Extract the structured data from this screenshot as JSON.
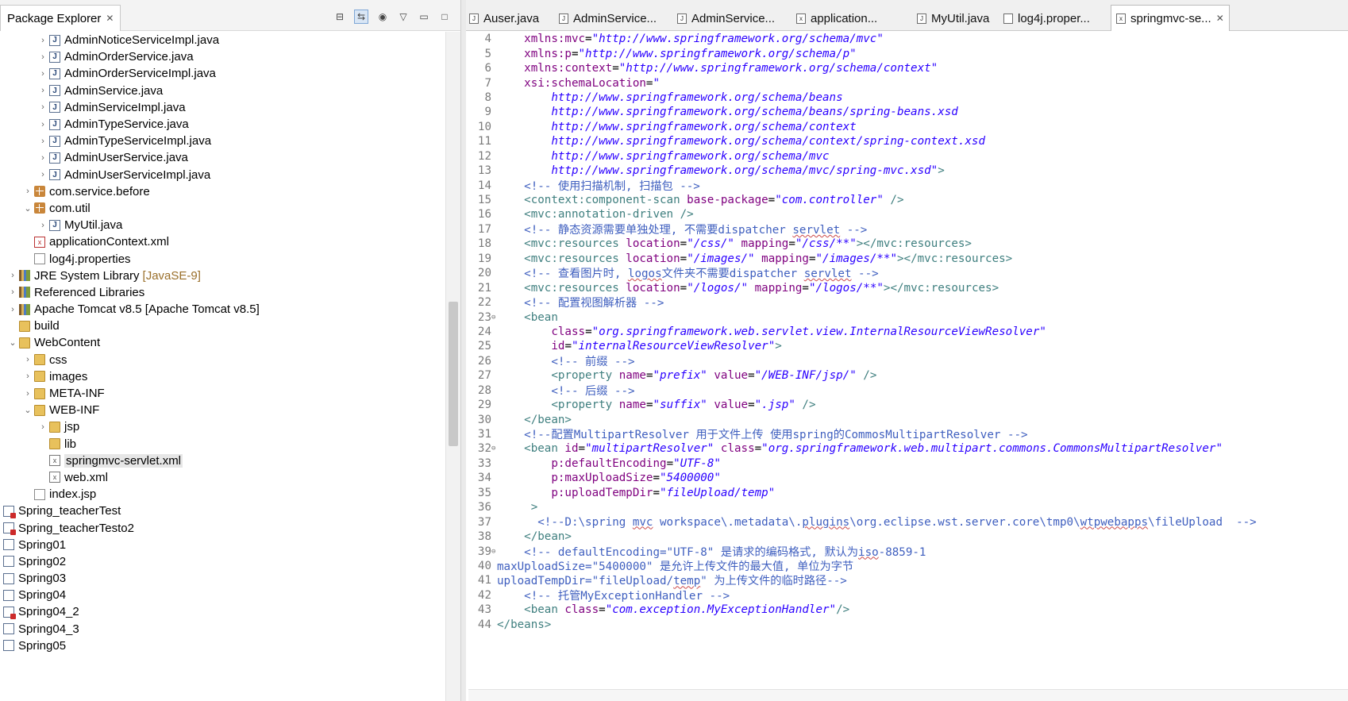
{
  "explorer": {
    "title": "Package Explorer",
    "items": [
      {
        "label": "AdminNoticeServiceImpl.java",
        "type": "java",
        "indent": 2,
        "twisty": "collapsed"
      },
      {
        "label": "AdminOrderService.java",
        "type": "java",
        "indent": 2,
        "twisty": "collapsed"
      },
      {
        "label": "AdminOrderServiceImpl.java",
        "type": "java",
        "indent": 2,
        "twisty": "collapsed"
      },
      {
        "label": "AdminService.java",
        "type": "java",
        "indent": 2,
        "twisty": "collapsed"
      },
      {
        "label": "AdminServiceImpl.java",
        "type": "java",
        "indent": 2,
        "twisty": "collapsed"
      },
      {
        "label": "AdminTypeService.java",
        "type": "java",
        "indent": 2,
        "twisty": "collapsed"
      },
      {
        "label": "AdminTypeServiceImpl.java",
        "type": "java",
        "indent": 2,
        "twisty": "collapsed"
      },
      {
        "label": "AdminUserService.java",
        "type": "java",
        "indent": 2,
        "twisty": "collapsed"
      },
      {
        "label": "AdminUserServiceImpl.java",
        "type": "java",
        "indent": 2,
        "twisty": "collapsed"
      },
      {
        "label": "com.service.before",
        "type": "package",
        "indent": 1,
        "twisty": "collapsed"
      },
      {
        "label": "com.util",
        "type": "package",
        "indent": 1,
        "twisty": "expanded"
      },
      {
        "label": "MyUtil.java",
        "type": "java",
        "indent": 2,
        "twisty": "collapsed"
      },
      {
        "label": "applicationContext.xml",
        "type": "xml-red",
        "indent": 1,
        "twisty": "none"
      },
      {
        "label": "log4j.properties",
        "type": "file",
        "indent": 1,
        "twisty": "none"
      },
      {
        "label": "JRE System Library",
        "decoration": "[JavaSE-9]",
        "type": "lib",
        "indent": 0,
        "twisty": "collapsed"
      },
      {
        "label": "Referenced Libraries",
        "type": "lib",
        "indent": 0,
        "twisty": "collapsed"
      },
      {
        "label": "Apache Tomcat v8.5 [Apache Tomcat v8.5]",
        "type": "lib",
        "indent": 0,
        "twisty": "collapsed"
      },
      {
        "label": "build",
        "type": "folder",
        "indent": 0,
        "twisty": "none"
      },
      {
        "label": "WebContent",
        "type": "folder",
        "indent": 0,
        "twisty": "expanded"
      },
      {
        "label": "css",
        "type": "folder",
        "indent": 1,
        "twisty": "collapsed"
      },
      {
        "label": "images",
        "type": "folder",
        "indent": 1,
        "twisty": "collapsed"
      },
      {
        "label": "META-INF",
        "type": "folder",
        "indent": 1,
        "twisty": "collapsed"
      },
      {
        "label": "WEB-INF",
        "type": "folder",
        "indent": 1,
        "twisty": "expanded"
      },
      {
        "label": "jsp",
        "type": "folder",
        "indent": 2,
        "twisty": "collapsed"
      },
      {
        "label": "lib",
        "type": "folder",
        "indent": 2,
        "twisty": "none"
      },
      {
        "label": "springmvc-servlet.xml",
        "type": "xml",
        "indent": 2,
        "twisty": "none",
        "selected": true
      },
      {
        "label": "web.xml",
        "type": "xml",
        "indent": 2,
        "twisty": "none"
      },
      {
        "label": "index.jsp",
        "type": "jsp",
        "indent": 1,
        "twisty": "none"
      },
      {
        "label": "Spring_teacherTest",
        "type": "project-err",
        "indent": -1,
        "twisty": "none"
      },
      {
        "label": "Spring_teacherTesto2",
        "type": "project-err",
        "indent": -1,
        "twisty": "none"
      },
      {
        "label": "Spring01",
        "type": "project",
        "indent": -1,
        "twisty": "none"
      },
      {
        "label": "Spring02",
        "type": "project",
        "indent": -1,
        "twisty": "none"
      },
      {
        "label": "Spring03",
        "type": "project",
        "indent": -1,
        "twisty": "none"
      },
      {
        "label": "Spring04",
        "type": "project",
        "indent": -1,
        "twisty": "none"
      },
      {
        "label": "Spring04_2",
        "type": "project-err",
        "indent": -1,
        "twisty": "none"
      },
      {
        "label": "Spring04_3",
        "type": "project",
        "indent": -1,
        "twisty": "none"
      },
      {
        "label": "Spring05",
        "type": "project",
        "indent": -1,
        "twisty": "none"
      }
    ]
  },
  "editor_tabs": [
    {
      "label": "Auser.java",
      "icon": "java-icon"
    },
    {
      "label": "AdminService...",
      "icon": "java-icon"
    },
    {
      "label": "AdminService...",
      "icon": "java-icon"
    },
    {
      "label": "application...",
      "icon": "xml-icon"
    },
    {
      "label": "MyUtil.java",
      "icon": "java-icon"
    },
    {
      "label": "log4j.proper...",
      "icon": "file-icon"
    },
    {
      "label": "springmvc-se...",
      "icon": "xml-icon",
      "active": true
    }
  ],
  "code_lines": [
    {
      "n": "4",
      "segs": [
        [
          "p",
          "    "
        ],
        [
          "a",
          "xmlns:mvc"
        ],
        [
          "p",
          "="
        ],
        [
          "v",
          "\"http://www.springframework.org/schema/mvc\""
        ]
      ]
    },
    {
      "n": "5",
      "segs": [
        [
          "p",
          "    "
        ],
        [
          "a",
          "xmlns:p"
        ],
        [
          "p",
          "="
        ],
        [
          "v",
          "\"http://www.springframework.org/schema/p\""
        ]
      ]
    },
    {
      "n": "6",
      "segs": [
        [
          "p",
          "    "
        ],
        [
          "a",
          "xmlns:context"
        ],
        [
          "p",
          "="
        ],
        [
          "v",
          "\"http://www.springframework.org/schema/context\""
        ]
      ]
    },
    {
      "n": "7",
      "segs": [
        [
          "p",
          "    "
        ],
        [
          "a",
          "xsi:schemaLocation"
        ],
        [
          "p",
          "="
        ],
        [
          "v",
          "\""
        ]
      ]
    },
    {
      "n": "8",
      "segs": [
        [
          "p",
          "        "
        ],
        [
          "v",
          "http://www.springframework.org/schema/beans"
        ]
      ]
    },
    {
      "n": "9",
      "segs": [
        [
          "p",
          "        "
        ],
        [
          "v",
          "http://www.springframework.org/schema/beans/spring-beans.xsd"
        ]
      ]
    },
    {
      "n": "10",
      "segs": [
        [
          "p",
          "        "
        ],
        [
          "v",
          "http://www.springframework.org/schema/context"
        ]
      ]
    },
    {
      "n": "11",
      "segs": [
        [
          "p",
          "        "
        ],
        [
          "v",
          "http://www.springframework.org/schema/context/spring-context.xsd"
        ]
      ]
    },
    {
      "n": "12",
      "segs": [
        [
          "p",
          "        "
        ],
        [
          "v",
          "http://www.springframework.org/schema/mvc"
        ]
      ]
    },
    {
      "n": "13",
      "segs": [
        [
          "p",
          "        "
        ],
        [
          "v",
          "http://www.springframework.org/schema/mvc/spring-mvc.xsd\""
        ],
        [
          "t",
          ">"
        ]
      ]
    },
    {
      "n": "14",
      "segs": [
        [
          "p",
          "    "
        ],
        [
          "c",
          "<!-- 使用扫描机制, 扫描包 -->"
        ]
      ]
    },
    {
      "n": "15",
      "segs": [
        [
          "p",
          "    "
        ],
        [
          "t",
          "<context:component-scan "
        ],
        [
          "a",
          "base-package"
        ],
        [
          "p",
          "="
        ],
        [
          "v",
          "\"com.controller\""
        ],
        [
          "t",
          " />"
        ]
      ]
    },
    {
      "n": "16",
      "segs": [
        [
          "p",
          "    "
        ],
        [
          "t",
          "<mvc:annotation-driven />"
        ]
      ]
    },
    {
      "n": "17",
      "segs": [
        [
          "p",
          "    "
        ],
        [
          "c",
          "<!-- 静态资源需要单独处理, 不需要dispatcher "
        ],
        [
          "csq",
          "servlet"
        ],
        [
          "c",
          " -->"
        ]
      ]
    },
    {
      "n": "18",
      "segs": [
        [
          "p",
          "    "
        ],
        [
          "t",
          "<mvc:resources "
        ],
        [
          "a",
          "location"
        ],
        [
          "p",
          "="
        ],
        [
          "v",
          "\"/css/\""
        ],
        [
          "p",
          " "
        ],
        [
          "a",
          "mapping"
        ],
        [
          "p",
          "="
        ],
        [
          "v",
          "\"/css/**\""
        ],
        [
          "t",
          "></mvc:resources>"
        ]
      ]
    },
    {
      "n": "19",
      "segs": [
        [
          "p",
          "    "
        ],
        [
          "t",
          "<mvc:resources "
        ],
        [
          "a",
          "location"
        ],
        [
          "p",
          "="
        ],
        [
          "v",
          "\"/images/\""
        ],
        [
          "p",
          " "
        ],
        [
          "a",
          "mapping"
        ],
        [
          "p",
          "="
        ],
        [
          "v",
          "\"/images/**\""
        ],
        [
          "t",
          "></mvc:resources>"
        ]
      ]
    },
    {
      "n": "20",
      "segs": [
        [
          "p",
          "    "
        ],
        [
          "c",
          "<!-- 查看图片时, "
        ],
        [
          "csq",
          "logos"
        ],
        [
          "c",
          "文件夹不需要dispatcher "
        ],
        [
          "csq",
          "servlet"
        ],
        [
          "c",
          " -->"
        ]
      ]
    },
    {
      "n": "21",
      "segs": [
        [
          "p",
          "    "
        ],
        [
          "t",
          "<mvc:resources "
        ],
        [
          "a",
          "location"
        ],
        [
          "p",
          "="
        ],
        [
          "v",
          "\"/logos/\""
        ],
        [
          "p",
          " "
        ],
        [
          "a",
          "mapping"
        ],
        [
          "p",
          "="
        ],
        [
          "v",
          "\"/logos/**\""
        ],
        [
          "t",
          "></mvc:resources>"
        ]
      ]
    },
    {
      "n": "22",
      "segs": [
        [
          "p",
          "    "
        ],
        [
          "c",
          "<!-- 配置视图解析器 -->"
        ]
      ]
    },
    {
      "n": "23",
      "fold": "⊖",
      "segs": [
        [
          "p",
          "    "
        ],
        [
          "t",
          "<bean"
        ]
      ]
    },
    {
      "n": "24",
      "segs": [
        [
          "p",
          "        "
        ],
        [
          "a",
          "class"
        ],
        [
          "p",
          "="
        ],
        [
          "v",
          "\"org.springframework.web.servlet.view.InternalResourceViewResolver\""
        ]
      ]
    },
    {
      "n": "25",
      "segs": [
        [
          "p",
          "        "
        ],
        [
          "a",
          "id"
        ],
        [
          "p",
          "="
        ],
        [
          "v",
          "\"internalResourceViewResolver\""
        ],
        [
          "t",
          ">"
        ]
      ]
    },
    {
      "n": "26",
      "segs": [
        [
          "p",
          "        "
        ],
        [
          "c",
          "<!-- 前缀 -->"
        ]
      ]
    },
    {
      "n": "27",
      "segs": [
        [
          "p",
          "        "
        ],
        [
          "t",
          "<property "
        ],
        [
          "a",
          "name"
        ],
        [
          "p",
          "="
        ],
        [
          "v",
          "\"prefix\""
        ],
        [
          "p",
          " "
        ],
        [
          "a",
          "value"
        ],
        [
          "p",
          "="
        ],
        [
          "v",
          "\"/WEB-INF/jsp/\""
        ],
        [
          "t",
          " />"
        ]
      ]
    },
    {
      "n": "28",
      "segs": [
        [
          "p",
          "        "
        ],
        [
          "c",
          "<!-- 后缀 -->"
        ]
      ]
    },
    {
      "n": "29",
      "segs": [
        [
          "p",
          "        "
        ],
        [
          "t",
          "<property "
        ],
        [
          "a",
          "name"
        ],
        [
          "p",
          "="
        ],
        [
          "v",
          "\"suffix\""
        ],
        [
          "p",
          " "
        ],
        [
          "a",
          "value"
        ],
        [
          "p",
          "="
        ],
        [
          "v",
          "\".jsp\""
        ],
        [
          "t",
          " />"
        ]
      ]
    },
    {
      "n": "30",
      "segs": [
        [
          "p",
          "    "
        ],
        [
          "t",
          "</bean>"
        ]
      ]
    },
    {
      "n": "31",
      "segs": [
        [
          "p",
          "    "
        ],
        [
          "c",
          "<!--配置MultipartResolver 用于文件上传 使用spring的CommosMultipartResolver -->"
        ]
      ]
    },
    {
      "n": "32",
      "fold": "⊖",
      "segs": [
        [
          "p",
          "    "
        ],
        [
          "t",
          "<bean "
        ],
        [
          "a",
          "id"
        ],
        [
          "p",
          "="
        ],
        [
          "v",
          "\"multipartResolver\""
        ],
        [
          "p",
          " "
        ],
        [
          "a",
          "class"
        ],
        [
          "p",
          "="
        ],
        [
          "v",
          "\"org.springframework.web.multipart.commons.CommonsMultipartResolver\""
        ]
      ]
    },
    {
      "n": "33",
      "segs": [
        [
          "p",
          "        "
        ],
        [
          "a",
          "p:defaultEncoding"
        ],
        [
          "p",
          "="
        ],
        [
          "v",
          "\"UTF-8\""
        ]
      ]
    },
    {
      "n": "34",
      "segs": [
        [
          "p",
          "        "
        ],
        [
          "a",
          "p:maxUploadSize"
        ],
        [
          "p",
          "="
        ],
        [
          "v",
          "\"5400000\""
        ]
      ]
    },
    {
      "n": "35",
      "segs": [
        [
          "p",
          "        "
        ],
        [
          "a",
          "p:uploadTempDir"
        ],
        [
          "p",
          "="
        ],
        [
          "v",
          "\"fileUpload/temp\""
        ]
      ]
    },
    {
      "n": "36",
      "segs": [
        [
          "p",
          "     "
        ],
        [
          "t",
          ">"
        ]
      ]
    },
    {
      "n": "37",
      "segs": [
        [
          "p",
          "      "
        ],
        [
          "c",
          "<!--D:\\spring "
        ],
        [
          "csq",
          "mvc"
        ],
        [
          "c",
          " workspace\\.metadata\\."
        ],
        [
          "csq",
          "plugins"
        ],
        [
          "c",
          "\\org.eclipse.wst.server.core\\tmp0\\"
        ],
        [
          "csq",
          "wtpwebapps"
        ],
        [
          "c",
          "\\fileUpload  -->"
        ]
      ]
    },
    {
      "n": "38",
      "segs": [
        [
          "p",
          "    "
        ],
        [
          "t",
          "</bean>"
        ]
      ]
    },
    {
      "n": "39",
      "fold": "⊖",
      "segs": [
        [
          "p",
          "    "
        ],
        [
          "c",
          "<!-- defaultEncoding=\"UTF-8\" 是请求的编码格式, 默认为"
        ],
        [
          "csq",
          "iso"
        ],
        [
          "c",
          "-8859-1"
        ]
      ]
    },
    {
      "n": "40",
      "segs": [
        [
          "c",
          "maxUploadSize=\"5400000\" 是允许上传文件的最大值, 单位为字节"
        ]
      ]
    },
    {
      "n": "41",
      "segs": [
        [
          "c",
          "uploadTempDir=\"fileUpload/"
        ],
        [
          "csq",
          "temp"
        ],
        [
          "c",
          "\" 为上传文件的临时路径-->"
        ]
      ]
    },
    {
      "n": "42",
      "segs": [
        [
          "p",
          "    "
        ],
        [
          "c",
          "<!-- 托管MyExceptionHandler -->"
        ]
      ]
    },
    {
      "n": "43",
      "segs": [
        [
          "p",
          "    "
        ],
        [
          "t",
          "<bean "
        ],
        [
          "a",
          "class"
        ],
        [
          "p",
          "="
        ],
        [
          "v",
          "\"com.exception.MyExceptionHandler\""
        ],
        [
          "t",
          "/>"
        ]
      ]
    },
    {
      "n": "44",
      "segs": [
        [
          "t",
          "</beans>"
        ]
      ]
    }
  ]
}
